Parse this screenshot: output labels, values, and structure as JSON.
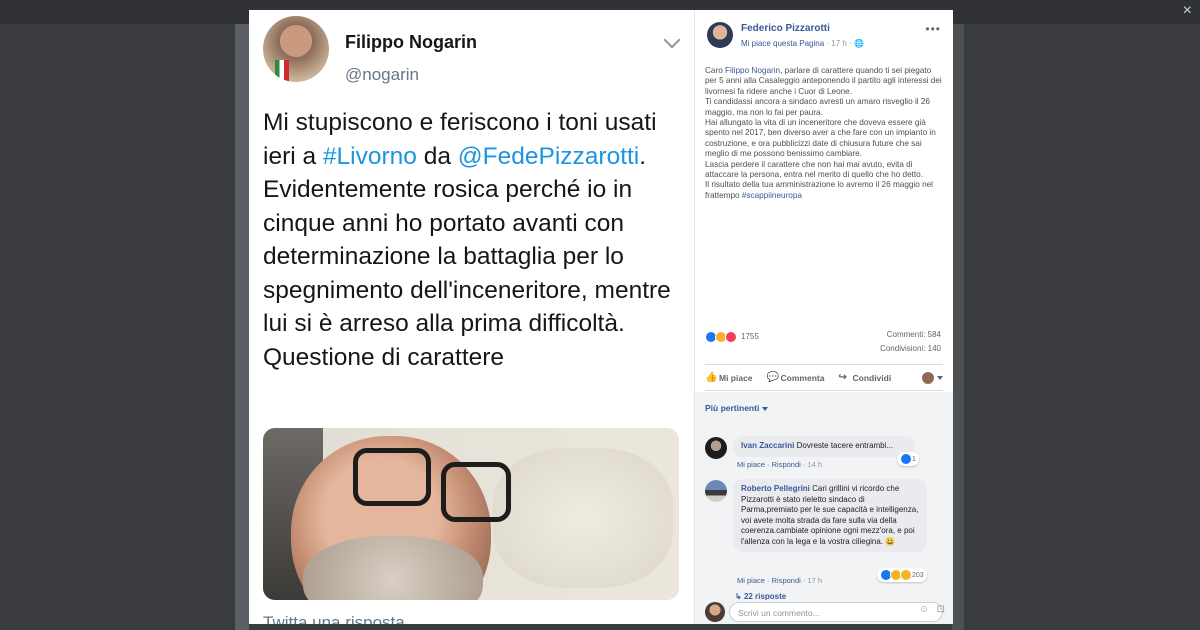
{
  "window": {
    "close_glyph": "×"
  },
  "tweet": {
    "author": "Filippo Nogarin",
    "handle": "@nogarin",
    "text_parts": {
      "t1": "Mi stupiscono e feriscono i toni usati ieri a ",
      "link1": "#Livorno",
      "t2": " da ",
      "link2": "@FedePizzarotti",
      "t3": ". Evidentemente rosica perché io in cinque anni ho portato avanti con determinazione la battaglia per lo spegnimento dell'inceneritore, mentre lui si è arreso alla prima difficoltà. Questione di carattere"
    },
    "reply_placeholder": "Twitta una risposta"
  },
  "facebook": {
    "page_name": "Federico Pizzarotti",
    "meta_like": "Mi piace questa Pagina",
    "meta_time": "17 h",
    "post": {
      "p1_a": "Caro ",
      "p1_link": "Filippo Nogarin",
      "p1_b": ", parlare di carattere quando ti sei piegato per 5 anni alla Casaleggio anteponendo il partito agli interessi dei livornesi fa ridere anche i Cuor di Leone.",
      "p2": "Ti candidassi ancora a sindaco avresti un amaro risveglio il 26 maggio, ma non lo fai per paura.",
      "p3": "Hai allungato la vita di un inceneritore che doveva essere già spento nel 2017, ben diverso aver a che fare con un impianto in costruzione, e ora pubblicizzi date di chiusura future che sai meglio di me possono benissimo cambiare.",
      "p4": "Lascia perdere il carattere che non hai mai avuto, evita di attaccare la persona, entra nel merito di quello che ho detto.",
      "p5_a": "Il risultato della tua amministrazione lo avremo il 26 maggio nel frattempo ",
      "p5_link": "#scappiineuropa"
    },
    "reactions_count": "1755",
    "comments_count": "Commenti: 584",
    "shares_count": "Condivisioni: 140",
    "actions": {
      "like": "Mi piace",
      "comment": "Commenta",
      "share": "Condividi"
    },
    "sort_label": "Più pertinenti",
    "comments": [
      {
        "author": "Ivan Zaccarini",
        "text": "Dovreste tacere entrambi...",
        "like": "Mi piace",
        "reply": "Rispondi",
        "time": "14 h",
        "reactions": "1"
      },
      {
        "author": "Roberto Pellegrini",
        "text": "Cari grillini vi ricordo che Pizzarotti è stato rieletto sindaco di Parma,premiato per le sue capacità e intelligenza, voi avete molta strada da fare sulla via della coerenza.cambiate opinione ogni mezz'ora, e poi l'allenza con la lega e la vostra ciliegina. 😀",
        "like": "Mi piace",
        "reply": "Rispondi",
        "time": "17 h",
        "reactions": "203"
      }
    ],
    "replies_link": "22 risposte",
    "write_placeholder": "Scrivi un commento..."
  },
  "colors": {
    "twitter_link": "#1b95e0",
    "facebook_link": "#385898",
    "background": "#3a3b3e"
  }
}
